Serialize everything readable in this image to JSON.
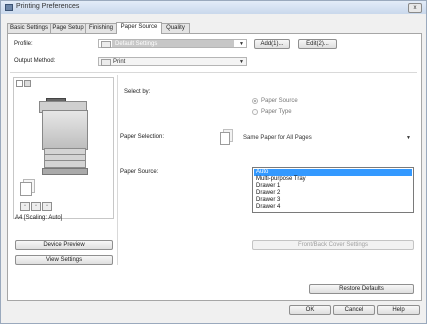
{
  "window": {
    "title": "Printing Preferences",
    "close_glyph": "x"
  },
  "tabs": [
    {
      "label": "Basic Settings",
      "active": false
    },
    {
      "label": "Page Setup",
      "active": false
    },
    {
      "label": "Finishing",
      "active": false
    },
    {
      "label": "Paper Source",
      "active": true
    },
    {
      "label": "Quality",
      "active": false
    }
  ],
  "profile": {
    "label": "Profile:",
    "value": "Default Settings",
    "add_button": "Add(1)...",
    "edit_button": "Edit(2)..."
  },
  "output_method": {
    "label": "Output Method:",
    "value": "Print"
  },
  "select_by": {
    "label": "Select by:",
    "options": [
      "Paper Source",
      "Paper Type"
    ],
    "selected": "Paper Source"
  },
  "paper_selection": {
    "label": "Paper Selection:",
    "value": "Same Paper for All Pages"
  },
  "paper_source": {
    "label": "Paper Source:",
    "items": [
      "Auto",
      "Multi-purpose Tray",
      "Drawer 1",
      "Drawer 2",
      "Drawer 3",
      "Drawer 4"
    ],
    "selected": "Auto"
  },
  "preview": {
    "caption": "A4 [Scaling: Auto]"
  },
  "buttons": {
    "device_preview": "Device Preview",
    "view_settings": "View Settings",
    "front_back_cover": "Front/Back Cover Settings",
    "restore_defaults": "Restore Defaults",
    "ok": "OK",
    "cancel": "Cancel",
    "help": "Help"
  },
  "colors": {
    "selection": "#3399ff",
    "window_border": "#9aa9bd"
  },
  "icons": [
    "printer-icon",
    "profile-icon",
    "print-output-icon",
    "paper-stack-icon"
  ]
}
